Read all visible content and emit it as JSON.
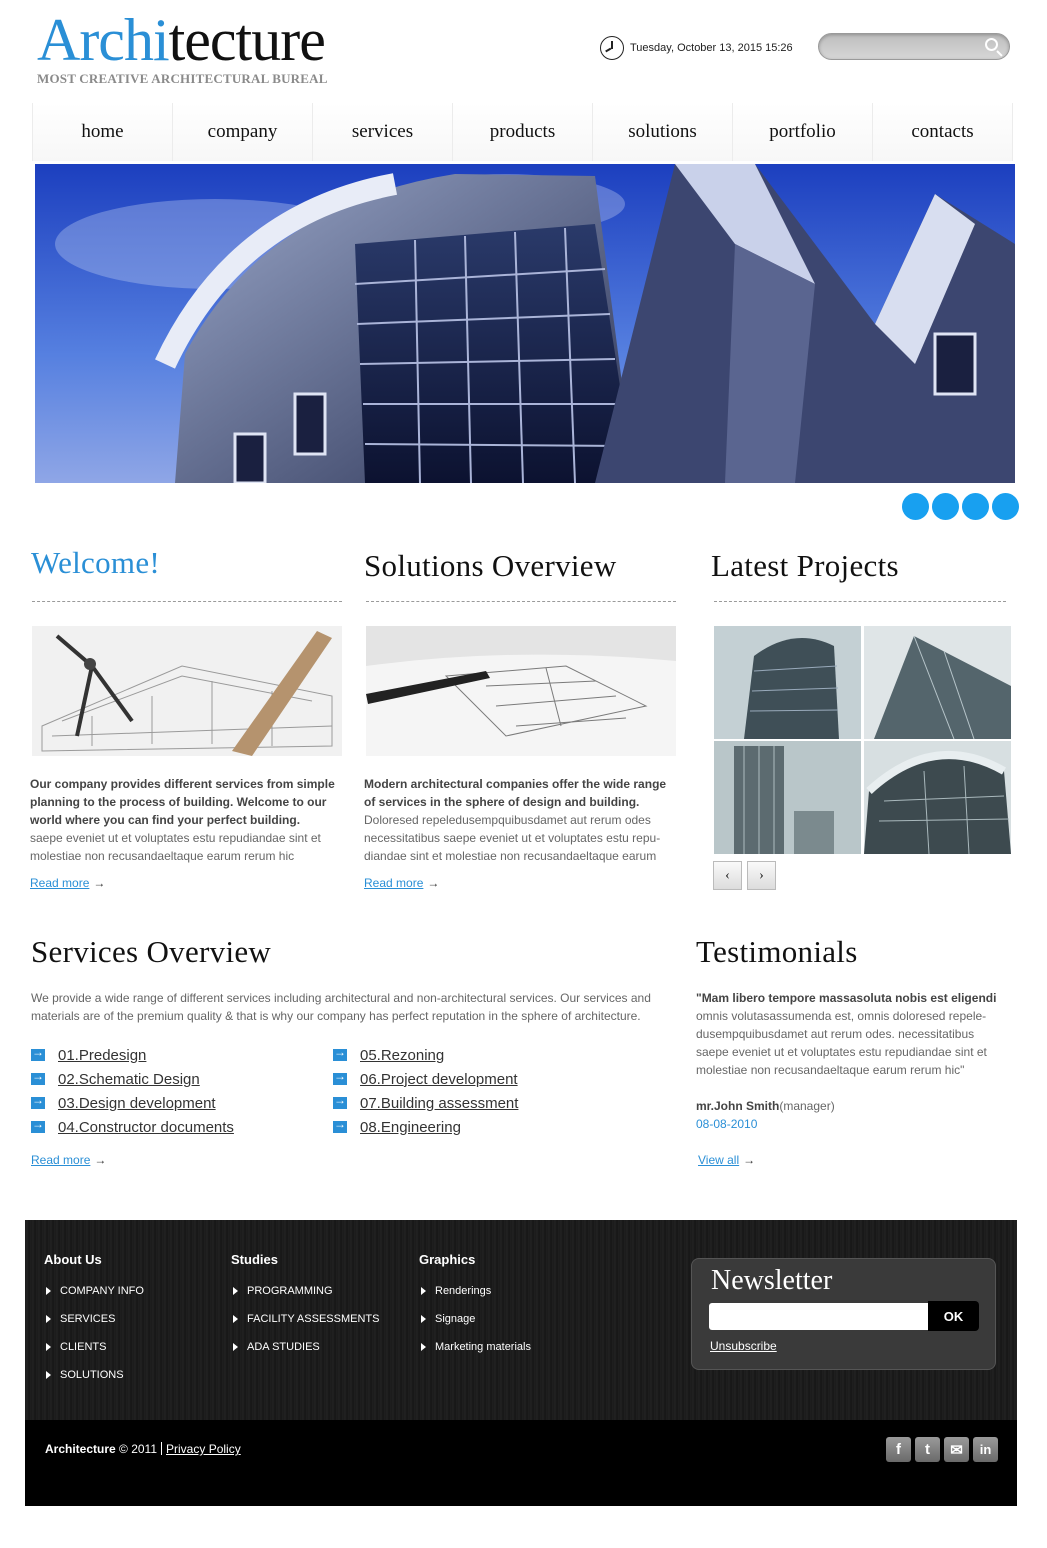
{
  "brand": {
    "title_accent": "Archi",
    "title_rest": "tecture",
    "tagline": "MOST CREATIVE ARCHITECTURAL BUREAL",
    "accent_color": "#2a8fd6"
  },
  "header": {
    "datetime": "Tuesday, October 13, 2015 15:26",
    "search_placeholder": ""
  },
  "nav": [
    "home",
    "company",
    "services",
    "products",
    "solutions",
    "portfolio",
    "contacts"
  ],
  "welcome": {
    "title": "Welcome!",
    "bold_text": "Our company provides different services from simple planning to the process of building. Welcome to our world where you can find your perfect building.",
    "text": "saepe eveniet ut et voluptates estu repudiandae sint et molestiae non recusandaeltaque earum rerum hic",
    "read_more": "Read more"
  },
  "solutions": {
    "title": "Solutions Overview",
    "bold_text": "Modern architectural companies offer the wide range of services in the sphere of design and building.",
    "text": "Doloresed repeledusempquibusdamet aut rerum odes necessitatibus saepe eveniet ut et voluptates estu repu- diandae sint et molestiae non recusandaeltaque earum",
    "read_more": "Read more"
  },
  "projects": {
    "title": "Latest Projects",
    "prev": "‹",
    "next": "›"
  },
  "services": {
    "title": "Services Overview",
    "intro": "We provide a wide range of different services including architectural and non-architectural services. Our services and materials are of the premium quality & that is why our company has perfect reputation in the sphere of architecture.",
    "col1": [
      "01.Predesign",
      "02.Schematic Design",
      "03.Design development",
      "04.Constructor documents"
    ],
    "col2": [
      "05.Rezoning",
      "06.Project development",
      "07.Building assessment",
      "08.Engineering"
    ],
    "read_more": "Read more"
  },
  "testimonials": {
    "title": "Testimonials",
    "bold_quote": "\"Mam libero tempore massasoluta nobis est eligendi",
    "quote": "omnis volutasassumenda est, omnis doloresed repele- dusempquibusdamet aut rerum odes. necessitatibus saepe eveniet ut et voluptates estu repudiandae sint et molestiae non recusandaeltaque earum rerum hic\"",
    "author": "mr.John Smith",
    "role": "(manager)",
    "date": "08-08-2010",
    "view_all": "View all"
  },
  "footer": {
    "about": {
      "title": "About Us",
      "items": [
        "COMPANY INFO",
        "SERVICES",
        "CLIENTS",
        "SOLUTIONS"
      ]
    },
    "studies": {
      "title": "Studies",
      "items": [
        "PROGRAMMING",
        "FACILITY ASSESSMENTS",
        "ADA STUDIES"
      ]
    },
    "graphics": {
      "title": "Graphics",
      "items": [
        "Renderings",
        "Signage",
        "Marketing materials"
      ]
    },
    "newsletter": {
      "title": "Newsletter",
      "button": "OK",
      "unsubscribe": "Unsubscribe"
    },
    "copyright_brand": "Architecture",
    "copyright_text": "© 2011",
    "privacy": "Privacy Policy",
    "social": [
      "facebook-icon",
      "twitter-icon",
      "email-icon",
      "linkedin-icon"
    ]
  }
}
